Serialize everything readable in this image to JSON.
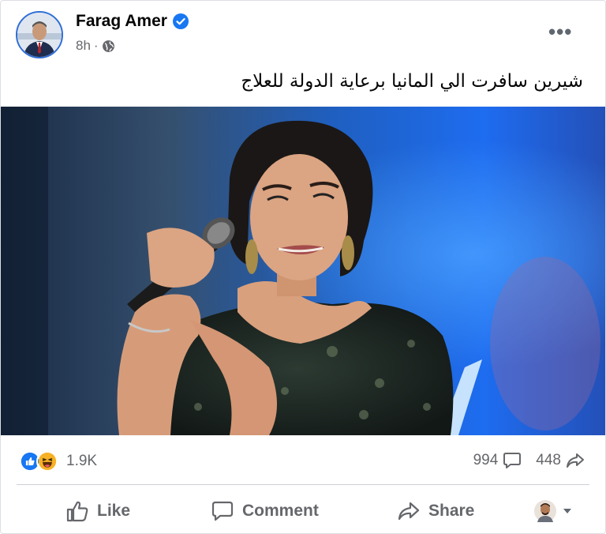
{
  "post": {
    "author": "Farag Amer",
    "time": "8h",
    "separator": "·",
    "caption": "شيرين سافرت الي المانيا برعاية الدولة للعلاج",
    "more_label": "•••"
  },
  "stats": {
    "reactions_count": "1.9K",
    "comments_count": "994",
    "shares_count": "448"
  },
  "actions": {
    "like": "Like",
    "comment": "Comment",
    "share": "Share"
  },
  "colors": {
    "accent": "#1877f2",
    "text_secondary": "#65676b",
    "verified": "#1877f2",
    "haha": "#f7b125"
  },
  "icons": {
    "verified": "verified-badge-icon",
    "audience": "globe-icon",
    "more": "more-options-icon",
    "like_reaction": "like-reaction-icon",
    "haha_reaction": "haha-reaction-icon",
    "comment": "comment-icon",
    "share": "share-icon",
    "like": "thumbs-up-icon"
  }
}
